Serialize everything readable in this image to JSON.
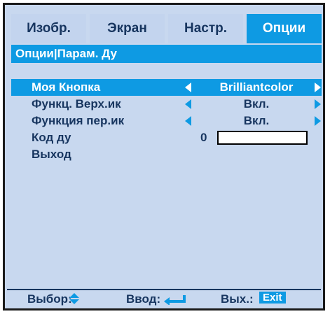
{
  "tabs": [
    {
      "label": "Изобр."
    },
    {
      "label": "Экран"
    },
    {
      "label": "Настр."
    },
    {
      "label": "Опции",
      "active": true
    }
  ],
  "breadcrumb": "Опции|Парам. Ду",
  "rows": [
    {
      "label": "Моя Кнопка",
      "value": "Brilliantcolor",
      "selected": true
    },
    {
      "label": "Функц. Верх.ик",
      "value": "Вкл."
    },
    {
      "label": "Функция пер.ик",
      "value": "Вкл."
    },
    {
      "label": "Код ду",
      "value": "0"
    },
    {
      "label": "Выход"
    }
  ],
  "footer": {
    "select_label": "Выбор:",
    "enter_label": "Ввод:",
    "exit_label": "Вых.:",
    "exit_key": "Exit"
  },
  "colors": {
    "accent": "#0e9ae3",
    "panel": "#c8d8ef",
    "text": "#17355f"
  }
}
